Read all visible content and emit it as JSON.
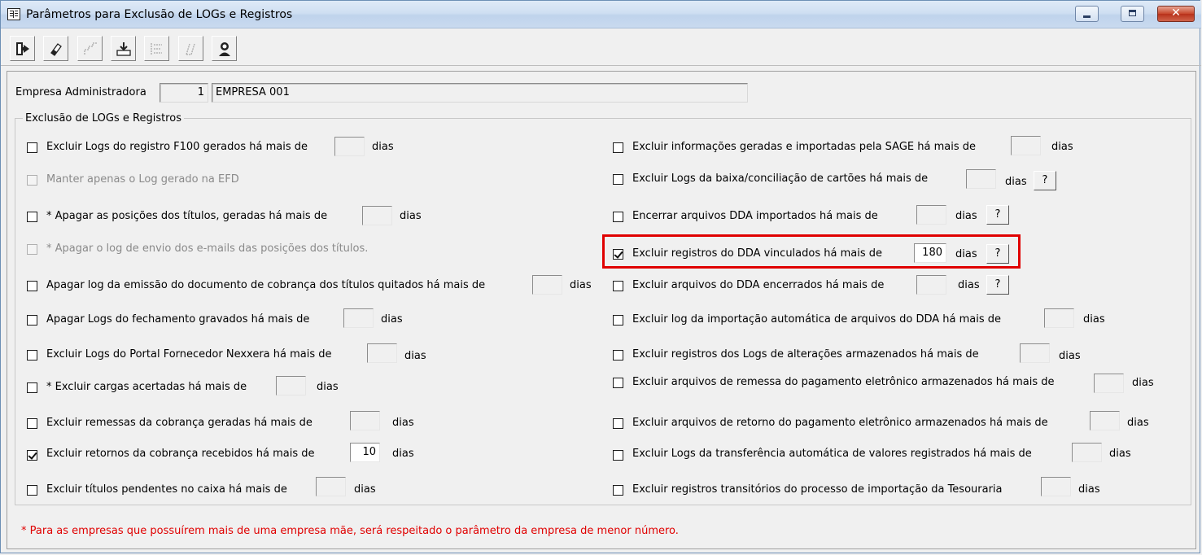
{
  "window": {
    "title": "Parâmetros para Exclusão de LOGs e Registros",
    "close_glyph": "✕"
  },
  "toolbar": {
    "buttons": [
      {
        "name": "exit-icon",
        "enabled": true
      },
      {
        "name": "eraser-icon",
        "enabled": true
      },
      {
        "name": "steps-icon",
        "enabled": false
      },
      {
        "name": "save-download-icon",
        "enabled": true
      },
      {
        "name": "list-icon",
        "enabled": false
      },
      {
        "name": "pen-icon",
        "enabled": false
      },
      {
        "name": "user-help-icon",
        "enabled": true
      }
    ]
  },
  "empresa": {
    "label": "Empresa Administradora",
    "code": "1",
    "name": "EMPRESA 001"
  },
  "group": {
    "title": "Exclusão de LOGs e Registros"
  },
  "left_options": [
    {
      "label": "Excluir Logs do registro F100 gerados há mais de",
      "checked": false,
      "disabled": false,
      "value": "",
      "suffix": "dias"
    },
    {
      "label": "Manter apenas o Log gerado na EFD",
      "checked": false,
      "disabled": true
    },
    {
      "label": "* Apagar as posições dos títulos, geradas há mais de",
      "checked": false,
      "disabled": false,
      "value": "",
      "suffix": "dias"
    },
    {
      "label": "* Apagar o log de envio dos e-mails das posições dos títulos.",
      "checked": false,
      "disabled": true
    },
    {
      "label": "Apagar log da emissão do documento de cobrança dos títulos quitados há mais de",
      "checked": false,
      "disabled": false,
      "value": "",
      "suffix": "dias"
    },
    {
      "label": "Apagar Logs do fechamento gravados há mais de",
      "checked": false,
      "disabled": false,
      "value": "",
      "suffix": "dias"
    },
    {
      "label": "Excluir Logs do Portal Fornecedor Nexxera há mais de",
      "checked": false,
      "disabled": false,
      "value": "",
      "suffix": "dias"
    },
    {
      "label": "* Excluir cargas acertadas há mais de",
      "checked": false,
      "disabled": false,
      "value": "",
      "suffix": "dias"
    },
    {
      "label": "Excluir remessas da cobrança geradas há mais de",
      "checked": false,
      "disabled": false,
      "value": "",
      "suffix": "dias"
    },
    {
      "label": "Excluir retornos da cobrança recebidos há mais de",
      "checked": true,
      "disabled": false,
      "value": "10",
      "suffix": "dias"
    },
    {
      "label": "Excluir títulos pendentes no caixa há mais de",
      "checked": false,
      "disabled": false,
      "value": "",
      "suffix": "dias"
    }
  ],
  "right_options": [
    {
      "label": "Excluir informações geradas e importadas pela SAGE há mais de",
      "checked": false,
      "value": "",
      "suffix": "dias",
      "help": ""
    },
    {
      "label": "Excluir Logs da baixa/conciliação de cartões há mais de",
      "checked": false,
      "value": "",
      "suffix": "dias",
      "help": "?"
    },
    {
      "label": "Encerrar arquivos DDA importados há mais de",
      "checked": false,
      "value": "",
      "suffix": "dias",
      "help": "?"
    },
    {
      "label": "Excluir registros do DDA vinculados há mais de",
      "checked": true,
      "value": "180",
      "suffix": "dias",
      "help": "?"
    },
    {
      "label": "Excluir arquivos do DDA encerrados há mais de",
      "checked": false,
      "value": "",
      "suffix": "dias",
      "help": "?"
    },
    {
      "label": "Excluir log da importação automática de arquivos do DDA há mais de",
      "checked": false,
      "value": "",
      "suffix": "dias",
      "help": ""
    },
    {
      "label": "Excluir registros dos Logs de alterações armazenados há mais de",
      "checked": false,
      "value": "",
      "suffix": "dias",
      "help": ""
    },
    {
      "label": "Excluir arquivos de remessa do pagamento eletrônico armazenados há mais de",
      "checked": false,
      "value": "",
      "suffix": "dias",
      "help": ""
    },
    {
      "label": "Excluir arquivos de retorno do pagamento eletrônico armazenados há mais de",
      "checked": false,
      "value": "",
      "suffix": "dias",
      "help": ""
    },
    {
      "label": "Excluir Logs da transferência automática de valores registrados há mais de",
      "checked": false,
      "value": "",
      "suffix": "dias",
      "help": ""
    },
    {
      "label": "Excluir registros transitórios do processo de importação da Tesouraria",
      "checked": false,
      "value": "",
      "suffix": "dias",
      "help": ""
    }
  ],
  "footer_note": "* Para as empresas que possuírem mais de uma empresa mãe, será respeitado o parâmetro da empresa de menor número.",
  "colors": {
    "note": "#e00000",
    "highlight": "#e00000"
  }
}
